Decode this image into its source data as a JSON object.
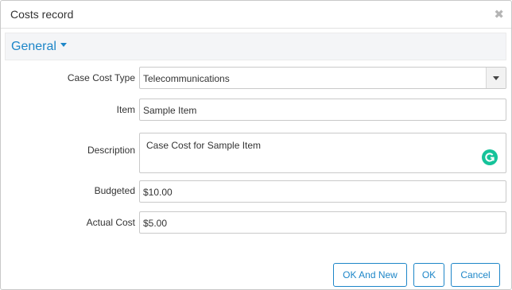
{
  "dialog": {
    "title": "Costs record",
    "close_icon": "close-icon"
  },
  "section": {
    "title": "General",
    "toggle_icon": "caret-down-icon"
  },
  "form": {
    "case_cost_type": {
      "label": "Case Cost Type",
      "value": "Telecommunications"
    },
    "item": {
      "label": "Item",
      "value": "Sample Item"
    },
    "description": {
      "label": "Description",
      "value": "Case Cost for Sample Item"
    },
    "budgeted": {
      "label": "Budgeted",
      "value": "$10.00"
    },
    "actual_cost": {
      "label": "Actual Cost",
      "value": "$5.00"
    }
  },
  "buttons": {
    "ok_and_new": "OK And New",
    "ok": "OK",
    "cancel": "Cancel"
  },
  "colors": {
    "accent": "#1d86c8",
    "section_bg": "#f4f5f7",
    "grammarly": "#15c39a"
  }
}
